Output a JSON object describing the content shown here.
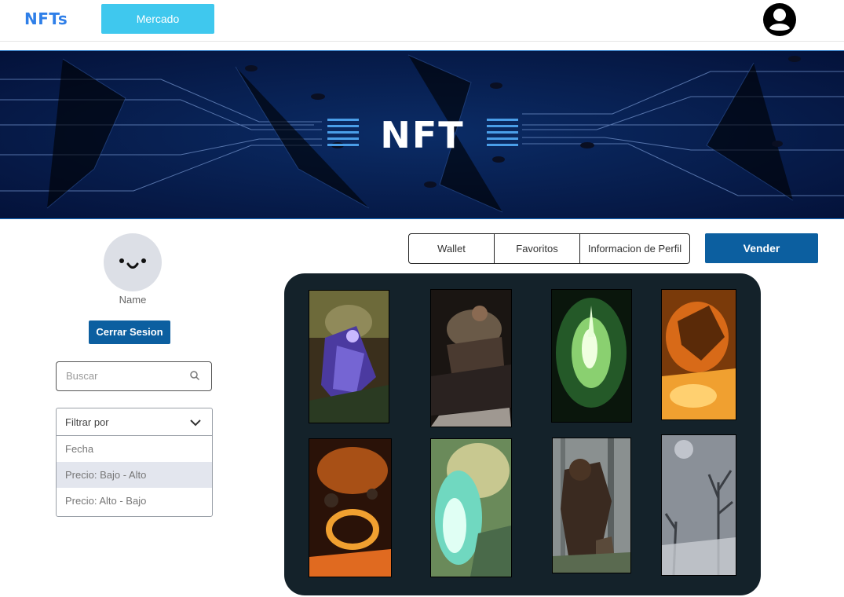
{
  "header": {
    "brand": "NFTs",
    "market_button": "Mercado"
  },
  "banner": {
    "logo_text": "NFT"
  },
  "profile": {
    "name": "Name",
    "logout_button": "Cerrar Sesion"
  },
  "search": {
    "placeholder": "Buscar"
  },
  "filter": {
    "label": "Filtrar por",
    "options": [
      "Fecha",
      "Precio: Bajo - Alto",
      "Precio: Alto - Bajo"
    ],
    "highlighted_option": "Precio: Bajo - Alto"
  },
  "tabs": [
    "Wallet",
    "Favoritos",
    "Informacion de Perfil"
  ],
  "sell_button": "Vender",
  "colors": {
    "brand": "#2f7fe8",
    "market_button": "#3fc8ee",
    "primary_button": "#0c5fa0",
    "gallery_bg": "#14222a"
  },
  "gallery": {
    "items": [
      {
        "art": "purple-warrior-art"
      },
      {
        "art": "brute-warrior-art"
      },
      {
        "art": "green-light-figure-art"
      },
      {
        "art": "fire-dragon-art"
      },
      {
        "art": "fire-ring-art"
      },
      {
        "art": "teal-energy-art"
      },
      {
        "art": "bear-forest-art"
      },
      {
        "art": "misty-forest-art"
      }
    ]
  }
}
